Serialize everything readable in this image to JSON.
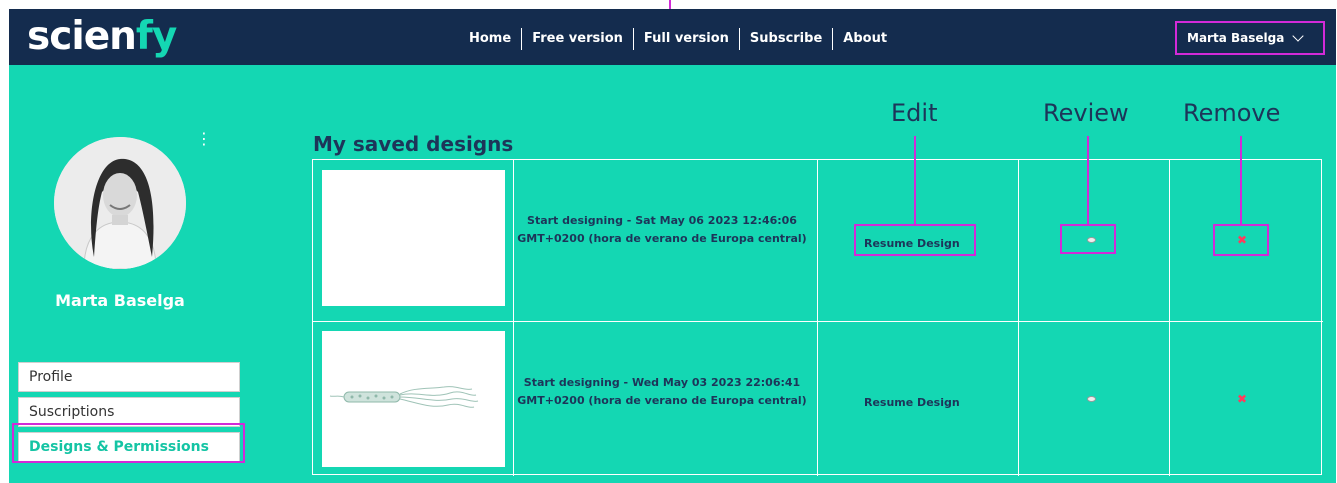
{
  "header": {
    "logo_part1": "scien",
    "logo_part2": "fy",
    "nav": [
      "Home",
      "Free version",
      "Full version",
      "Subscribe",
      "About"
    ],
    "user_menu": "Marta Baselga"
  },
  "sidebar": {
    "name": "Marta Baselga",
    "items": [
      {
        "label": "Profile"
      },
      {
        "label": "Suscriptions"
      },
      {
        "label": "Designs & Permissions"
      }
    ]
  },
  "main": {
    "title": "My saved designs",
    "column_labels": {
      "edit": "Edit",
      "review": "Review",
      "remove": "Remove"
    },
    "rows": [
      {
        "description": "Start designing - Sat May 06 2023 12:46:06 GMT+0200 (hora de verano de Europa central)",
        "action": "Resume Design"
      },
      {
        "description": "Start designing - Wed May 03 2023 22:06:41 GMT+0200 (hora de verano de Europa central)",
        "action": "Resume Design"
      }
    ]
  },
  "colors": {
    "header": "#142c4e",
    "background": "#14d7b3",
    "highlight": "#d22ad8",
    "title": "#1d3559",
    "remove": "#ff3b5c"
  },
  "icons": [
    "chevron-down-icon",
    "more-vertical-icon",
    "eye-icon",
    "close-icon"
  ]
}
